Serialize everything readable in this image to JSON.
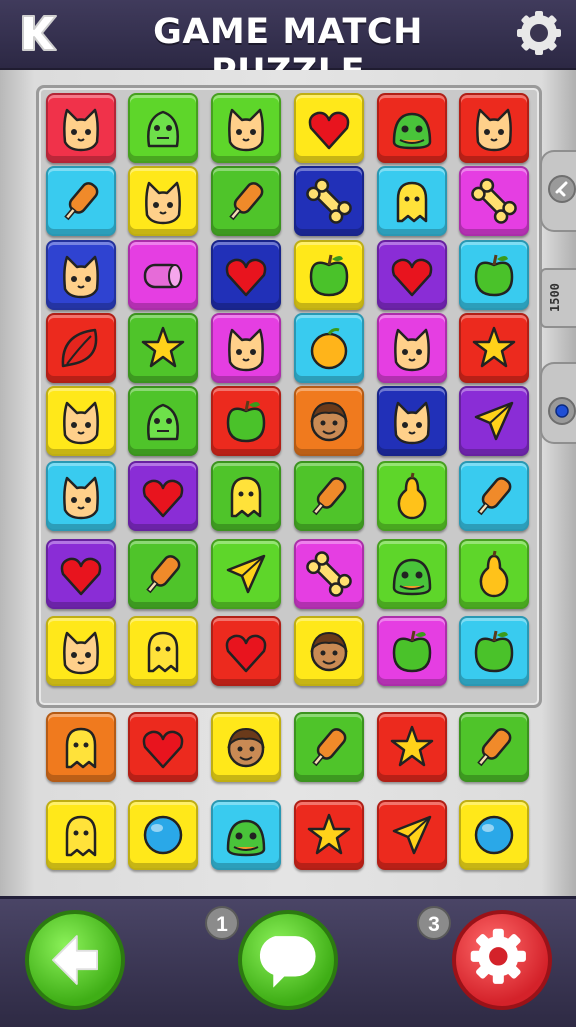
{
  "header": {
    "title": "GAME MATCH PUZZLE",
    "back_icon": "k-back-icon",
    "settings_icon": "gear-icon"
  },
  "board": {
    "rows": [
      [
        {
          "color": "#f0324a",
          "icon": "cat"
        },
        {
          "color": "#5ed62a",
          "icon": "monster"
        },
        {
          "color": "#5ed62a",
          "icon": "cat"
        },
        {
          "color": "#ffe81a",
          "icon": "heart"
        },
        {
          "color": "#ec2a1e",
          "icon": "blob"
        },
        {
          "color": "#ec2a1e",
          "icon": "cat"
        }
      ],
      [
        {
          "color": "#39cbef",
          "icon": "popsicle"
        },
        {
          "color": "#ffe81a",
          "icon": "cat"
        },
        {
          "color": "#4fc42a",
          "icon": "popsicle"
        },
        {
          "color": "#2130b8",
          "icon": "bone"
        },
        {
          "color": "#39cbef",
          "icon": "ghost"
        },
        {
          "color": "#e53ee2",
          "icon": "bone"
        }
      ],
      [
        {
          "color": "#2f43d1",
          "icon": "cat"
        },
        {
          "color": "#e53ee2",
          "icon": "roll"
        },
        {
          "color": "#2130b8",
          "icon": "heart"
        },
        {
          "color": "#ffe81a",
          "icon": "apple"
        },
        {
          "color": "#8a2dd6",
          "icon": "heart"
        },
        {
          "color": "#39cbef",
          "icon": "apple"
        }
      ],
      [
        {
          "color": "#ec2a1e",
          "icon": "leaf"
        },
        {
          "color": "#4fc42a",
          "icon": "star"
        },
        {
          "color": "#e53ee2",
          "icon": "cat"
        },
        {
          "color": "#39cbef",
          "icon": "orange"
        },
        {
          "color": "#e53ee2",
          "icon": "cat"
        },
        {
          "color": "#ec2a1e",
          "icon": "star"
        }
      ],
      [
        {
          "color": "#ffe81a",
          "icon": "cat"
        },
        {
          "color": "#4fc42a",
          "icon": "monster"
        },
        {
          "color": "#ec2a1e",
          "icon": "apple"
        },
        {
          "color": "#f07a1e",
          "icon": "face"
        },
        {
          "color": "#2130b8",
          "icon": "cat"
        },
        {
          "color": "#8a2dd6",
          "icon": "plane"
        }
      ],
      [
        {
          "color": "#39cbef",
          "icon": "cat"
        },
        {
          "color": "#8a2dd6",
          "icon": "heart"
        },
        {
          "color": "#4fc42a",
          "icon": "ghost"
        },
        {
          "color": "#4fc42a",
          "icon": "popsicle"
        },
        {
          "color": "#5ed62a",
          "icon": "pear"
        },
        {
          "color": "#39cbef",
          "icon": "popsicle"
        }
      ],
      [
        {
          "color": "#8a2dd6",
          "icon": "heart"
        },
        {
          "color": "#4fc42a",
          "icon": "popsicle"
        },
        {
          "color": "#5ed62a",
          "icon": "plane"
        },
        {
          "color": "#e53ee2",
          "icon": "bone"
        },
        {
          "color": "#5ed62a",
          "icon": "blob"
        },
        {
          "color": "#5ed62a",
          "icon": "pear"
        }
      ],
      [
        {
          "color": "#ffe81a",
          "icon": "cat"
        },
        {
          "color": "#ffe81a",
          "icon": "ghost"
        },
        {
          "color": "#ec2a1e",
          "icon": "heart"
        },
        {
          "color": "#ffe81a",
          "icon": "face"
        },
        {
          "color": "#e53ee2",
          "icon": "apple"
        },
        {
          "color": "#39cbef",
          "icon": "apple"
        }
      ]
    ]
  },
  "tray": {
    "rows": [
      [
        {
          "color": "#f07a1e",
          "icon": "ghost"
        },
        {
          "color": "#ec2a1e",
          "icon": "heart"
        },
        {
          "color": "#ffe81a",
          "icon": "face"
        },
        {
          "color": "#4fc42a",
          "icon": "popsicle"
        },
        {
          "color": "#ec2a1e",
          "icon": "star"
        },
        {
          "color": "#4fc42a",
          "icon": "popsicle"
        }
      ],
      [
        {
          "color": "#ffe81a",
          "icon": "ghost"
        },
        {
          "color": "#ffe81a",
          "icon": "ball"
        },
        {
          "color": "#39cbef",
          "icon": "blob"
        },
        {
          "color": "#ec2a1e",
          "icon": "star"
        },
        {
          "color": "#ec2a1e",
          "icon": "plane"
        },
        {
          "color": "#ffe81a",
          "icon": "ball"
        }
      ]
    ]
  },
  "side": {
    "top_icon": "arrow-icon",
    "counter_label": "1500",
    "bottom_icon": "dot-icon"
  },
  "footer": {
    "back_icon": "arrow-left-icon",
    "hint_badge": "1",
    "hint_icon": "speech-bubble-icon",
    "settings_badge": "3",
    "settings_icon": "gear-icon"
  }
}
